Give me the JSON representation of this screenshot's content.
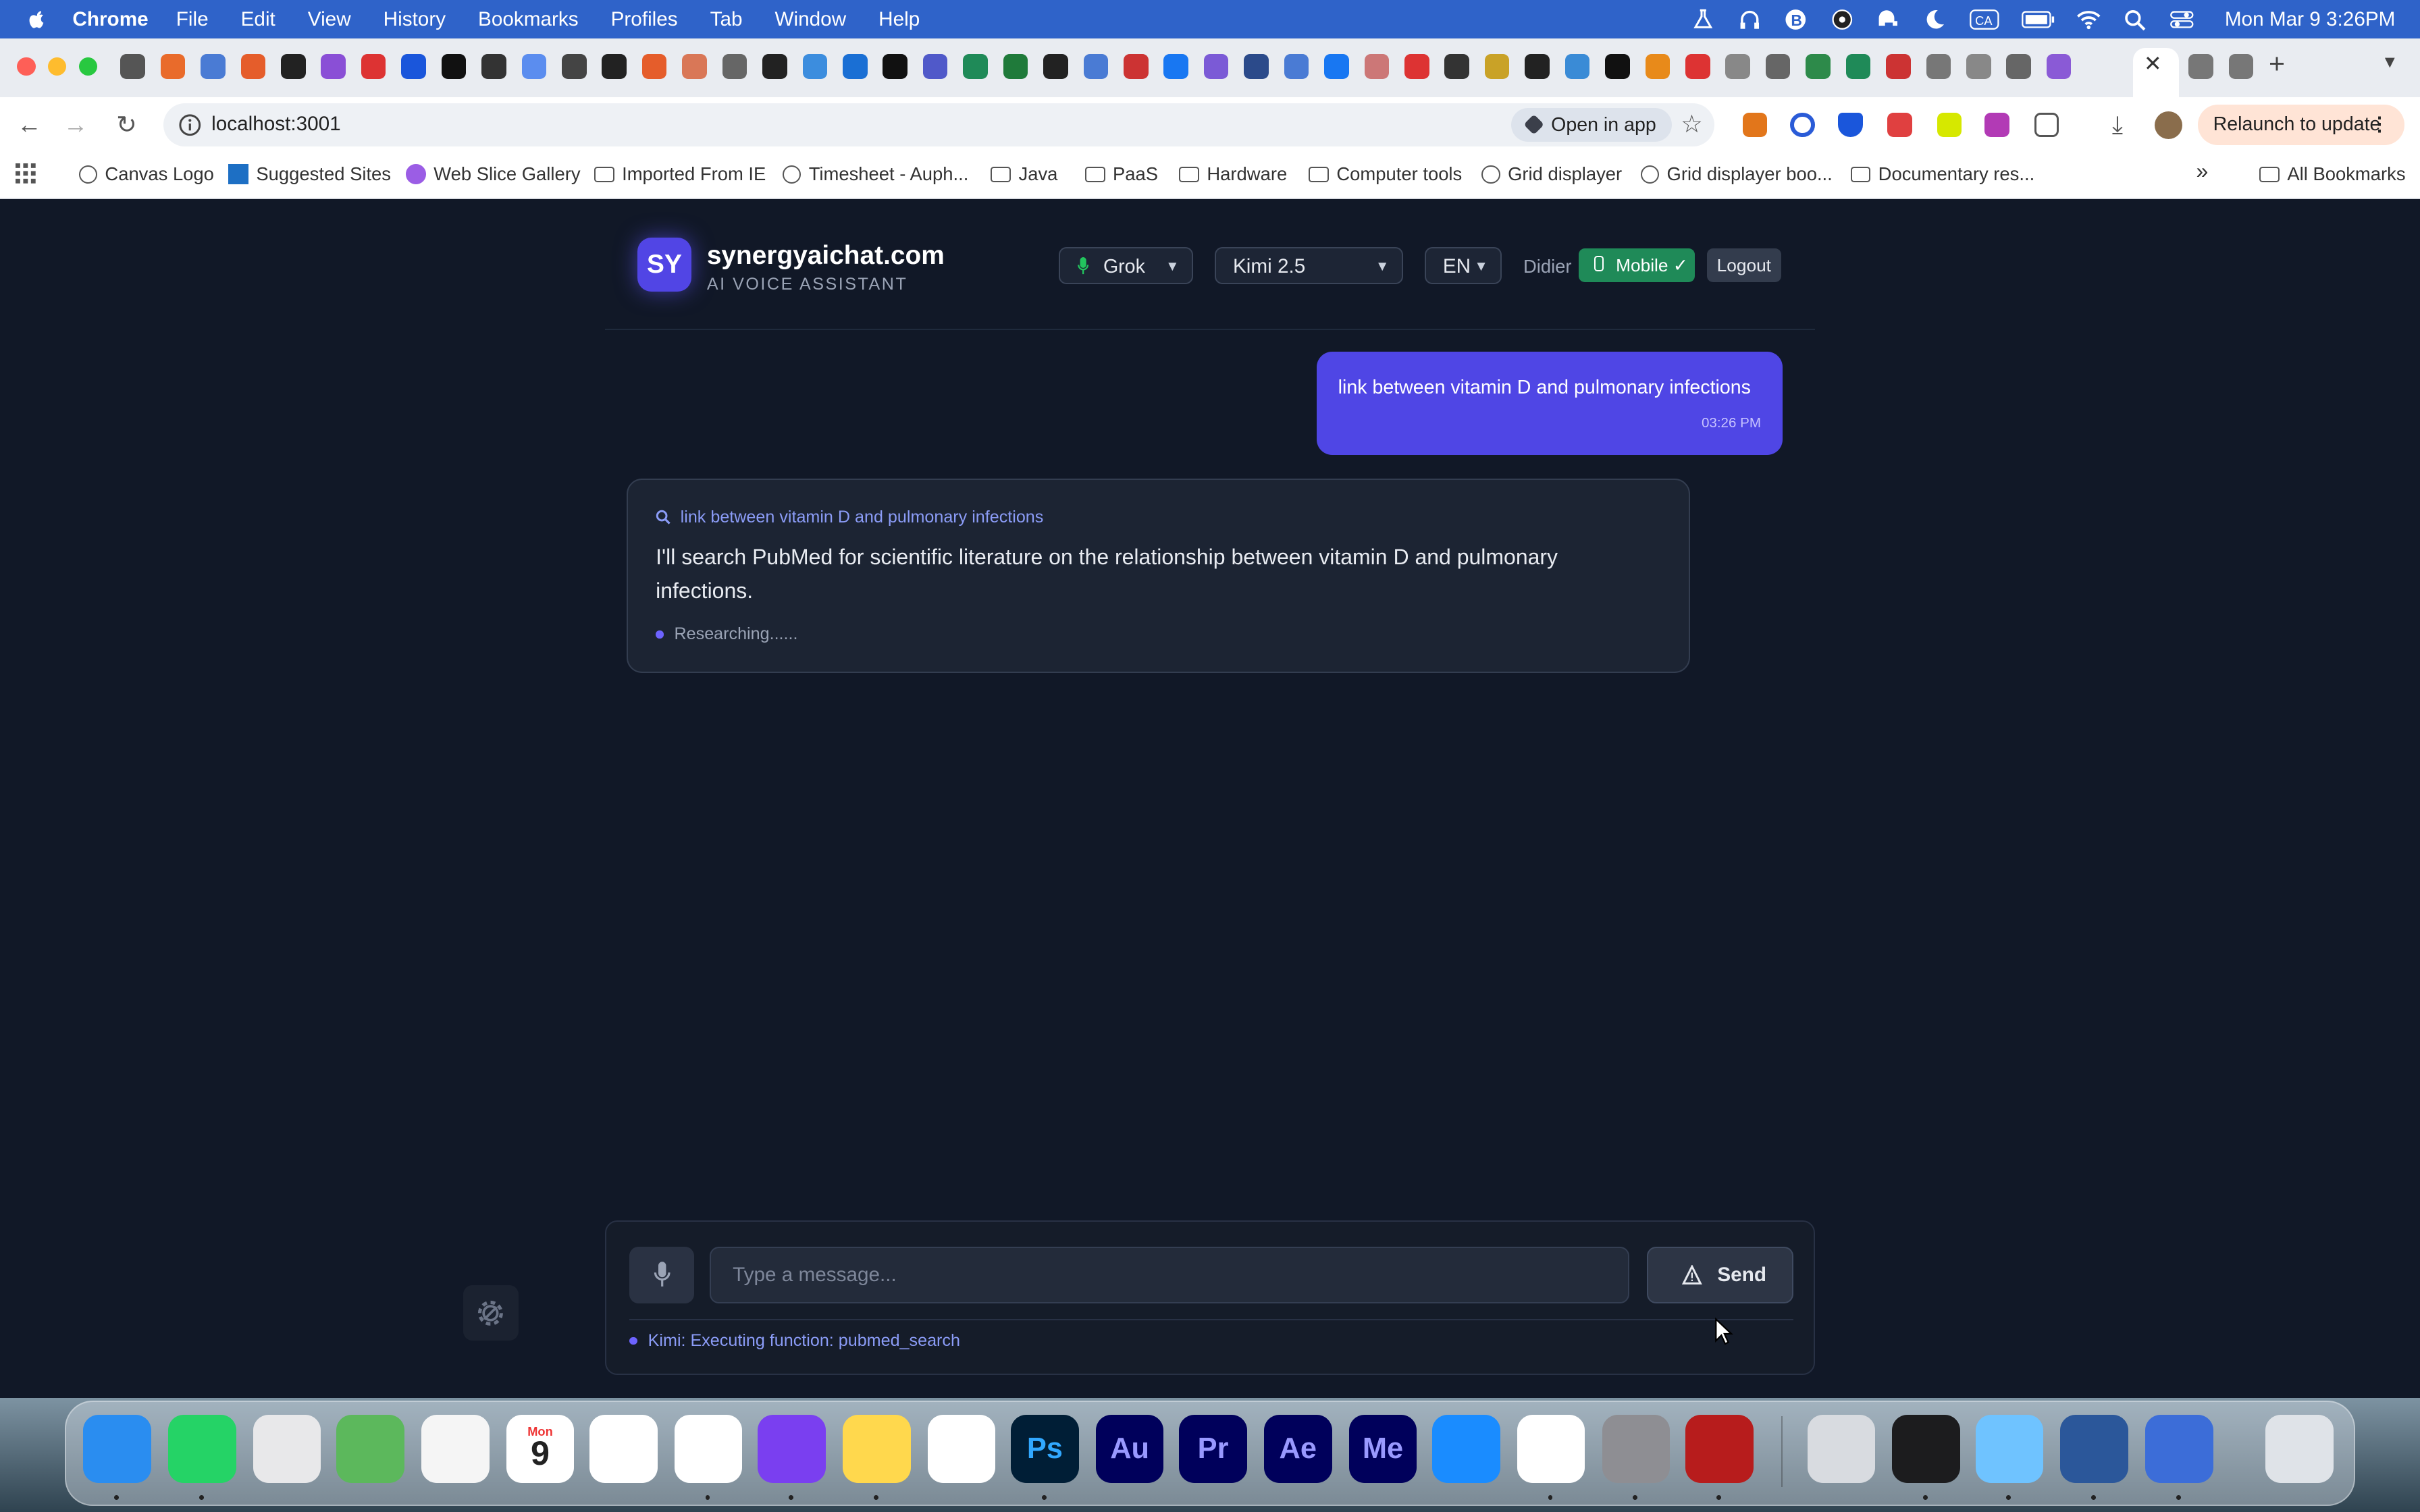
{
  "menubar": {
    "app": "Chrome",
    "items": [
      "File",
      "Edit",
      "View",
      "History",
      "Bookmarks",
      "Profiles",
      "Tab",
      "Window",
      "Help"
    ],
    "clock": "Mon Mar 9  3:26PM",
    "ca_label": "CA"
  },
  "toolbar": {
    "url": "localhost:3001",
    "open_in_app": "Open in app",
    "relaunch": "Relaunch to update"
  },
  "bookmarks": {
    "items": [
      "Canvas Logo",
      "Suggested Sites",
      "Web Slice Gallery",
      "Imported From IE",
      "Timesheet - Auph...",
      "Java",
      "PaaS",
      "Hardware",
      "Computer tools",
      "Grid displayer",
      "Grid displayer boo...",
      "Documentary res..."
    ],
    "more": "»",
    "all": "All Bookmarks"
  },
  "app": {
    "logo": "SY",
    "brand": "synergyaichat.com",
    "subtitle": "AI VOICE ASSISTANT",
    "voice_select": "Grok",
    "model_select": "Kimi 2.5",
    "lang_select": "EN",
    "user": "Didier",
    "mobile_badge": "Mobile ✓",
    "logout": "Logout"
  },
  "chat": {
    "user_message": "link between vitamin D and pulmonary infections",
    "user_time": "03:26 PM",
    "assistant_query": "link between vitamin D and pulmonary infections",
    "assistant_text": "I'll search PubMed for scientific literature on the relationship between vitamin D and pulmonary infections.",
    "assistant_status": "Researching......"
  },
  "composer": {
    "placeholder": "Type a message...",
    "send": "Send",
    "function_status": "Kimi: Executing function: pubmed_search"
  },
  "dock": {
    "labels": [
      "9",
      "Mon",
      "Ps",
      "Au",
      "Pr",
      "Ae",
      "Me"
    ]
  },
  "colors": {
    "page_bg": "#111827",
    "accent": "#4f46e5",
    "mobile_badge": "#1f8a58",
    "link": "#8b9cf7"
  }
}
